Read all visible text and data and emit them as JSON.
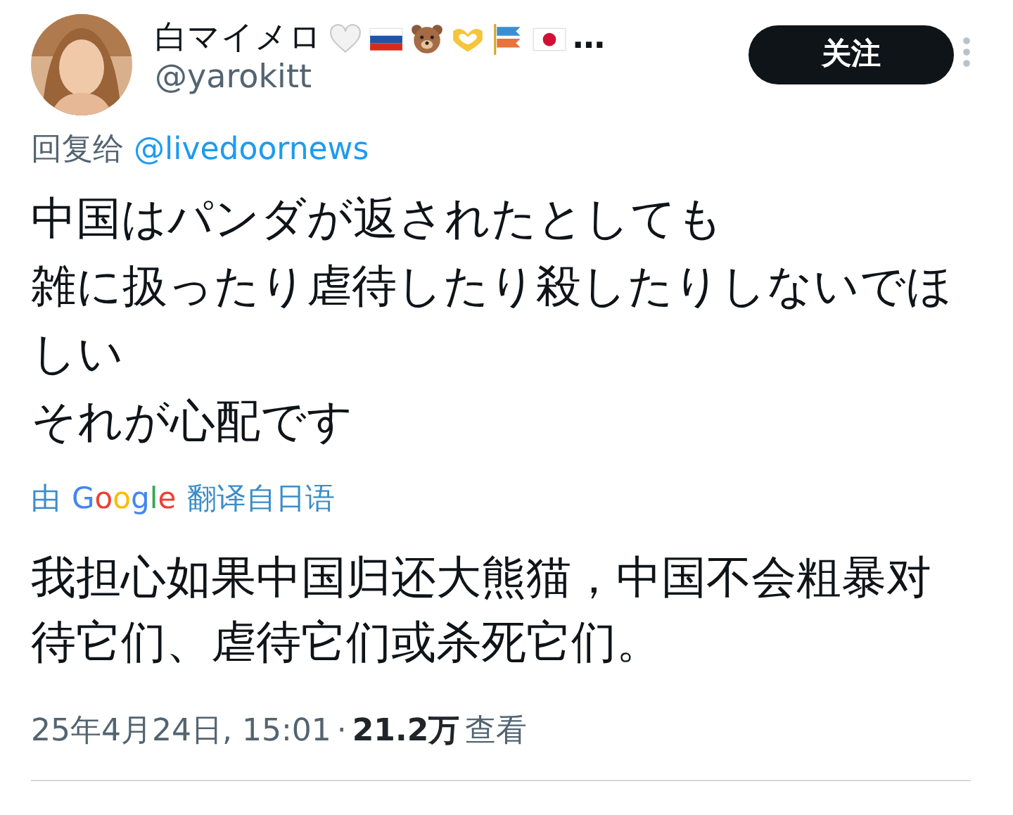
{
  "author": {
    "name": "白マイメロ",
    "name_icons": [
      {
        "kind": "heart"
      },
      {
        "kind": "flag-russia"
      },
      {
        "kind": "bear"
      },
      {
        "kind": "heart-hands"
      },
      {
        "kind": "carp-streamer"
      },
      {
        "kind": "flag-japan"
      }
    ],
    "name_more": "…",
    "handle": "@yarokitt"
  },
  "follow_button": "关注",
  "reply_to": {
    "label": "回复给",
    "handle": "@livedoornews"
  },
  "text_lines": [
    "中国はパンダが返されたとしても",
    "雑に扱ったり虐待したり殺したりしないでほしい",
    "それが心配です"
  ],
  "translation": {
    "prefix": "由",
    "provider": "Google",
    "suffix": "翻译自日语",
    "text": "我担心如果中国归还大熊猫，中国不会粗暴对待它们、虐待它们或杀死它们。"
  },
  "meta": {
    "timestamp": "25年4月24日, 15:01",
    "separator": "·",
    "views": "21.2万",
    "views_label": "查看"
  }
}
